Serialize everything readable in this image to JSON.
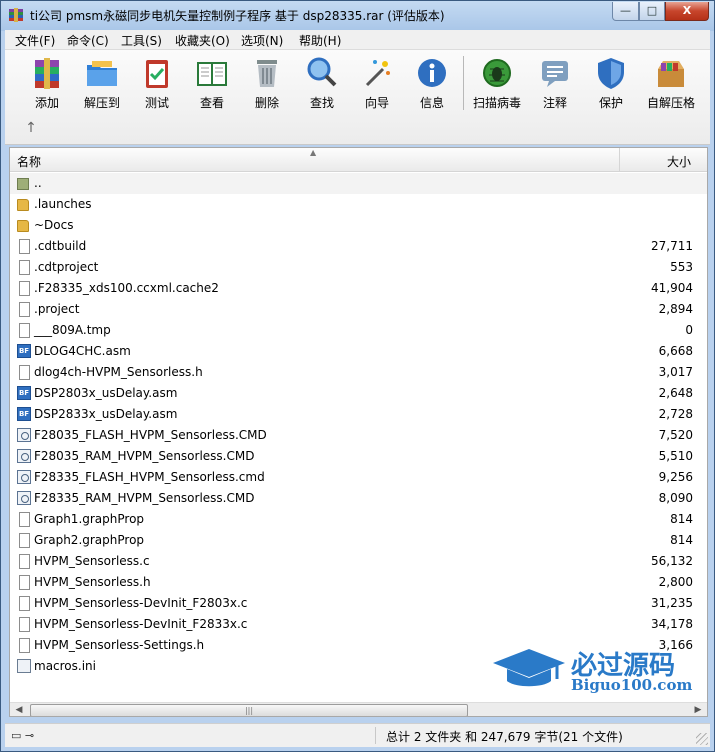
{
  "window": {
    "title": "ti公司 pmsm永磁同步电机矢量控制例子程序 基于 dsp28335.rar (评估版本)",
    "minimize": "—",
    "maximize": "□",
    "close": "X"
  },
  "menu": [
    {
      "label": "文件(F)"
    },
    {
      "label": "命令(C)"
    },
    {
      "label": "工具(S)"
    },
    {
      "label": "收藏夹(O)"
    },
    {
      "label": "选项(N)"
    },
    {
      "label": "帮助(H)"
    }
  ],
  "toolbar": [
    {
      "label": "添加",
      "icon": "add-archive-icon"
    },
    {
      "label": "解压到",
      "icon": "extract-folder-icon"
    },
    {
      "label": "测试",
      "icon": "test-clipboard-icon"
    },
    {
      "label": "查看",
      "icon": "view-book-icon"
    },
    {
      "label": "删除",
      "icon": "trash-icon"
    },
    {
      "label": "查找",
      "icon": "magnifier-icon"
    },
    {
      "label": "向导",
      "icon": "wizard-wand-icon"
    },
    {
      "label": "信息",
      "icon": "info-icon"
    },
    {
      "label": "扫描病毒",
      "icon": "virus-scan-icon"
    },
    {
      "label": "注释",
      "icon": "comment-icon"
    },
    {
      "label": "保护",
      "icon": "shield-icon"
    },
    {
      "label": "自解压格",
      "icon": "sfx-box-icon"
    }
  ],
  "up_button": "↑",
  "columns": {
    "name": "名称",
    "size": "大小",
    "sort_indicator": "▲"
  },
  "files": [
    {
      "name": "..",
      "size": "",
      "type": "parent"
    },
    {
      "name": ".launches",
      "size": "",
      "type": "folder"
    },
    {
      "name": "~Docs",
      "size": "",
      "type": "folder"
    },
    {
      "name": ".cdtbuild",
      "size": "27,711",
      "type": "file"
    },
    {
      "name": ".cdtproject",
      "size": "553",
      "type": "file"
    },
    {
      "name": ".F28335_xds100.ccxml.cache2",
      "size": "41,904",
      "type": "file"
    },
    {
      "name": ".project",
      "size": "2,894",
      "type": "file"
    },
    {
      "name": "___809A.tmp",
      "size": "0",
      "type": "file"
    },
    {
      "name": "DLOG4CHC.asm",
      "size": "6,668",
      "type": "asm"
    },
    {
      "name": "dlog4ch-HVPM_Sensorless.h",
      "size": "3,017",
      "type": "file"
    },
    {
      "name": "DSP2803x_usDelay.asm",
      "size": "2,648",
      "type": "asm"
    },
    {
      "name": "DSP2833x_usDelay.asm",
      "size": "2,728",
      "type": "asm"
    },
    {
      "name": "F28035_FLASH_HVPM_Sensorless.CMD",
      "size": "7,520",
      "type": "cmd"
    },
    {
      "name": "F28035_RAM_HVPM_Sensorless.CMD",
      "size": "5,510",
      "type": "cmd"
    },
    {
      "name": "F28335_FLASH_HVPM_Sensorless.cmd",
      "size": "9,256",
      "type": "cmd"
    },
    {
      "name": "F28335_RAM_HVPM_Sensorless.CMD",
      "size": "8,090",
      "type": "cmd"
    },
    {
      "name": "Graph1.graphProp",
      "size": "814",
      "type": "file"
    },
    {
      "name": "Graph2.graphProp",
      "size": "814",
      "type": "file"
    },
    {
      "name": "HVPM_Sensorless.c",
      "size": "56,132",
      "type": "file"
    },
    {
      "name": "HVPM_Sensorless.h",
      "size": "2,800",
      "type": "file"
    },
    {
      "name": "HVPM_Sensorless-DevInit_F2803x.c",
      "size": "31,235",
      "type": "file"
    },
    {
      "name": "HVPM_Sensorless-DevInit_F2833x.c",
      "size": "34,178",
      "type": "file"
    },
    {
      "name": "HVPM_Sensorless-Settings.h",
      "size": "3,166",
      "type": "file"
    },
    {
      "name": "macros.ini",
      "size": "",
      "type": "ini"
    }
  ],
  "scrollbar": {
    "left": "◀",
    "right": "▶",
    "grip": "|||"
  },
  "watermark": {
    "title": "必过源码",
    "url": "Biguo100.com"
  },
  "status": {
    "icons": "▭ ⊸",
    "text": "总计 2 文件夹 和 247,679 字节(21 个文件)"
  },
  "colors": {
    "title_bg": "#b9d1ee",
    "close_red": "#c7452c",
    "watermark": "#2a7ac8",
    "folder": "#e6b745"
  }
}
